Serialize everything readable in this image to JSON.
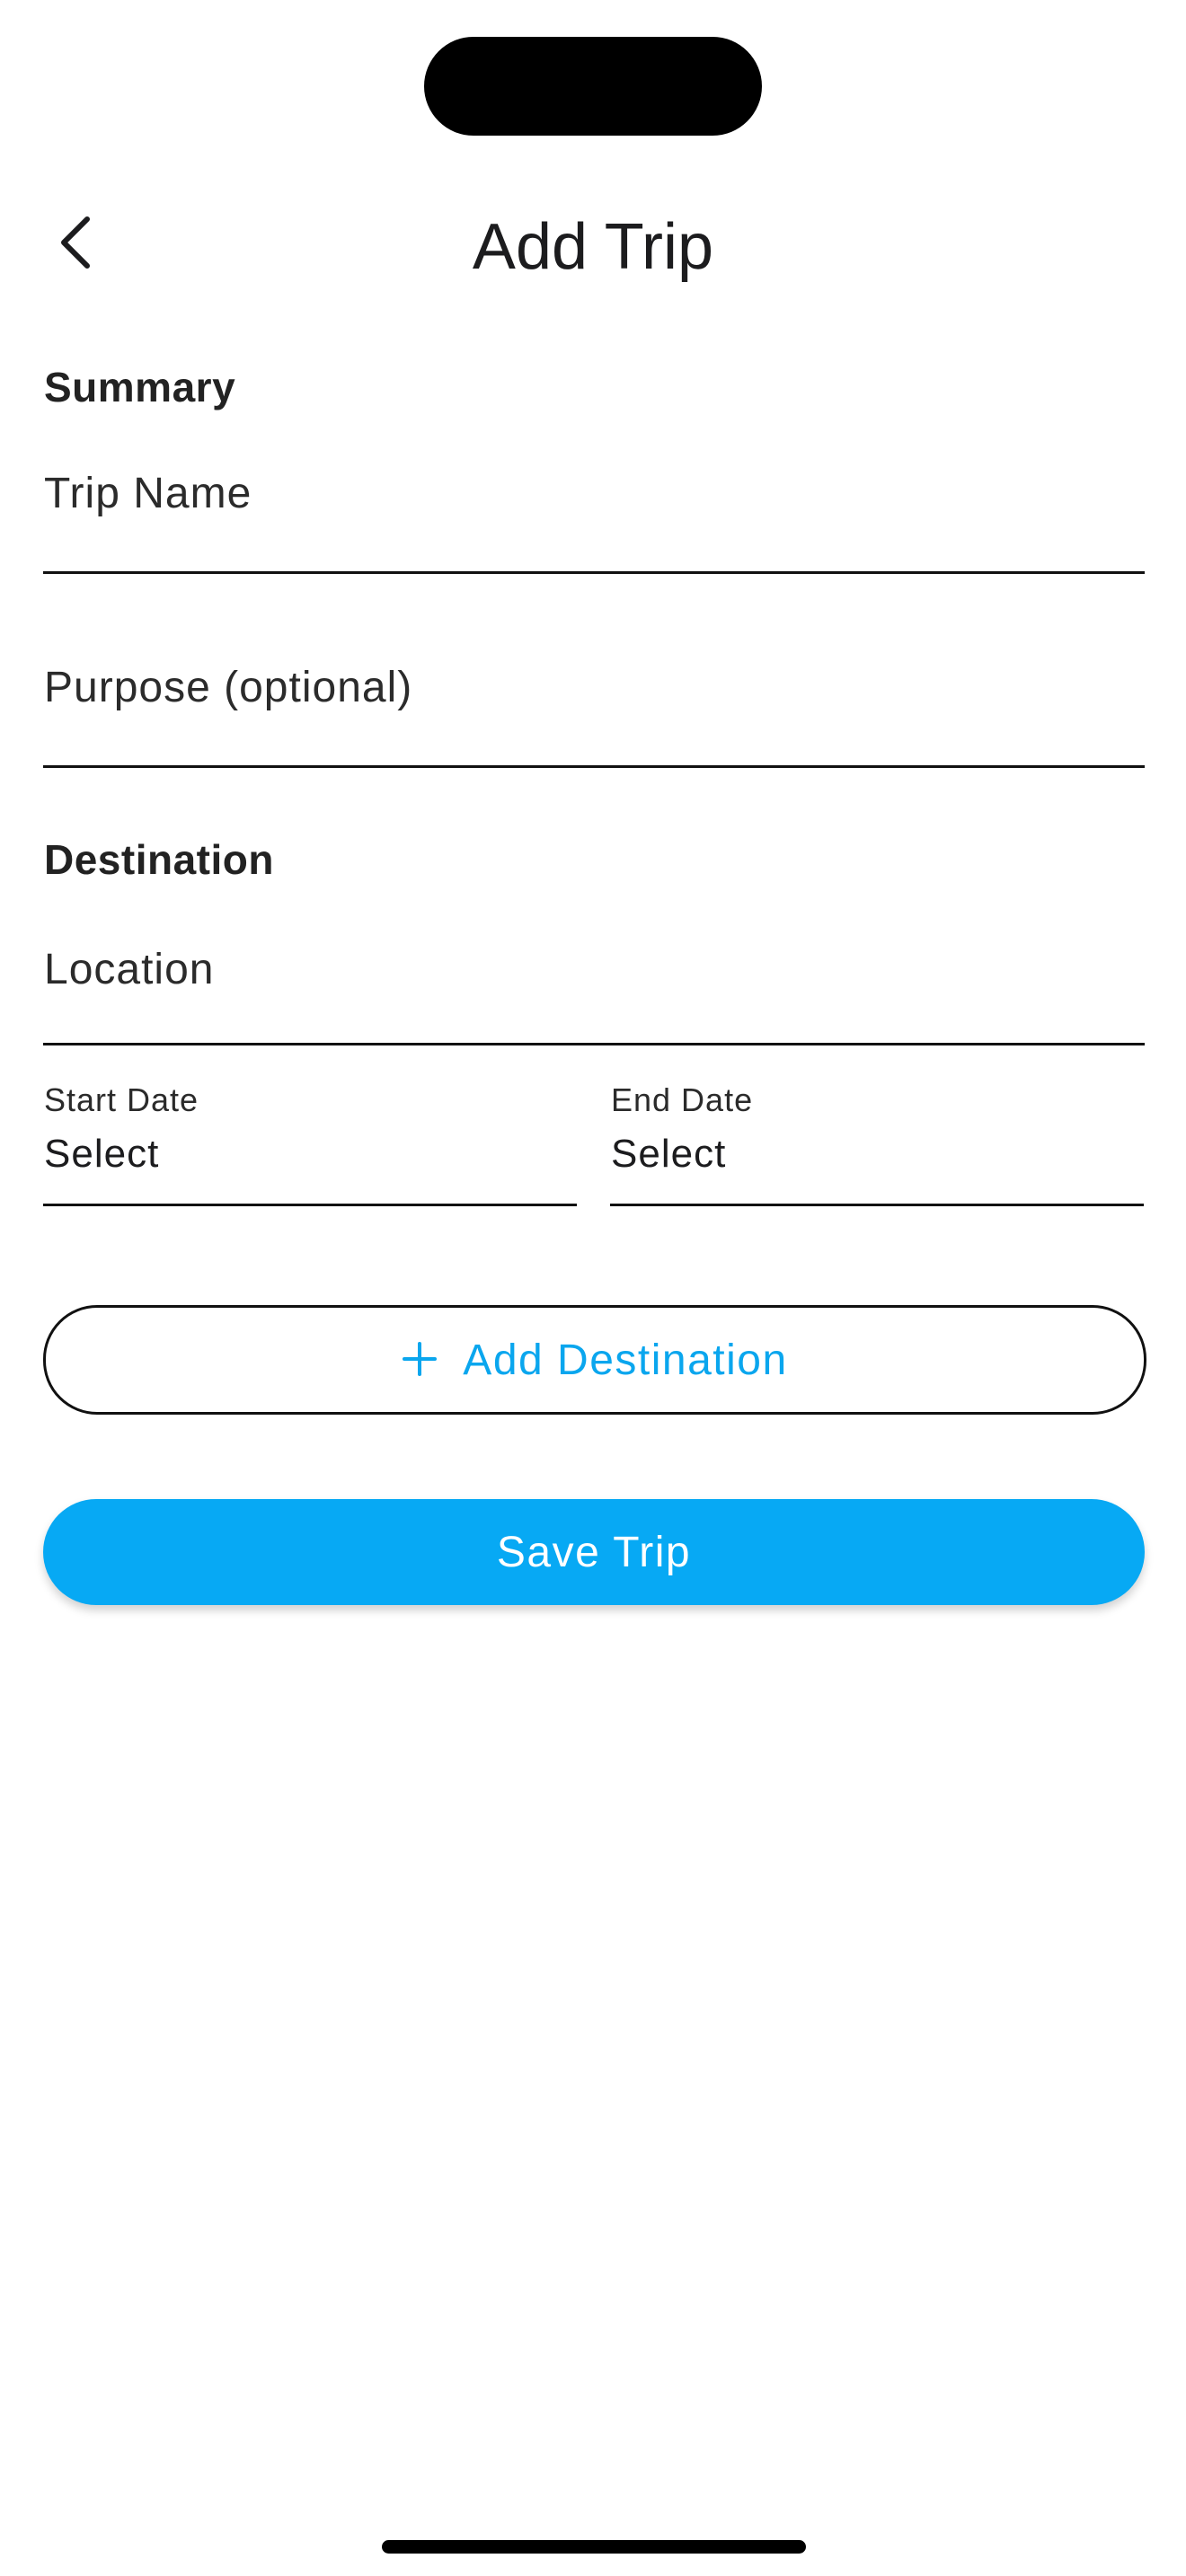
{
  "nav": {
    "title": "Add Trip",
    "back_icon": "chevron-left-icon"
  },
  "summary": {
    "header": "Summary",
    "trip_name_placeholder": "Trip Name",
    "purpose_placeholder": "Purpose (optional)"
  },
  "destination": {
    "header": "Destination",
    "location_placeholder": "Location",
    "start_date_label": "Start Date",
    "start_date_value": "Select",
    "end_date_label": "End Date",
    "end_date_value": "Select"
  },
  "actions": {
    "add_destination_icon": "plus-icon",
    "add_destination_label": "Add Destination",
    "save_label": "Save Trip"
  },
  "colors": {
    "accent": "#07a9f4",
    "text": "#1c1c1e"
  }
}
